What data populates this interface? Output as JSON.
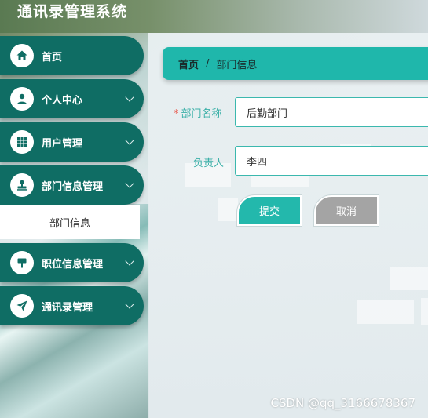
{
  "app": {
    "title": "通讯录管理系统"
  },
  "sidebar": {
    "items": [
      {
        "label": "首页",
        "icon": "home-icon",
        "expandable": false
      },
      {
        "label": "个人中心",
        "icon": "person-icon",
        "expandable": true
      },
      {
        "label": "用户管理",
        "icon": "grid-icon",
        "expandable": true
      },
      {
        "label": "部门信息管理",
        "icon": "stamp-icon",
        "expandable": true
      },
      {
        "label": "职位信息管理",
        "icon": "signpost-icon",
        "expandable": true
      },
      {
        "label": "通讯录管理",
        "icon": "paper-plane-icon",
        "expandable": true
      }
    ],
    "active_sub_item": "部门信息"
  },
  "breadcrumb": {
    "home": "首页",
    "separator": "/",
    "current": "部门信息"
  },
  "form": {
    "dept_name_label": "部门名称",
    "required_mark": "*",
    "dept_name_value": "后勤部门",
    "manager_label": "负责人",
    "manager_value": "李四",
    "submit_label": "提交",
    "cancel_label": "取消"
  },
  "watermark": "CSDN @qq_3166678367",
  "colors": {
    "sidebar": "#0f6d64",
    "accent": "#1fb7ab",
    "cancel": "#a4a4a4"
  }
}
